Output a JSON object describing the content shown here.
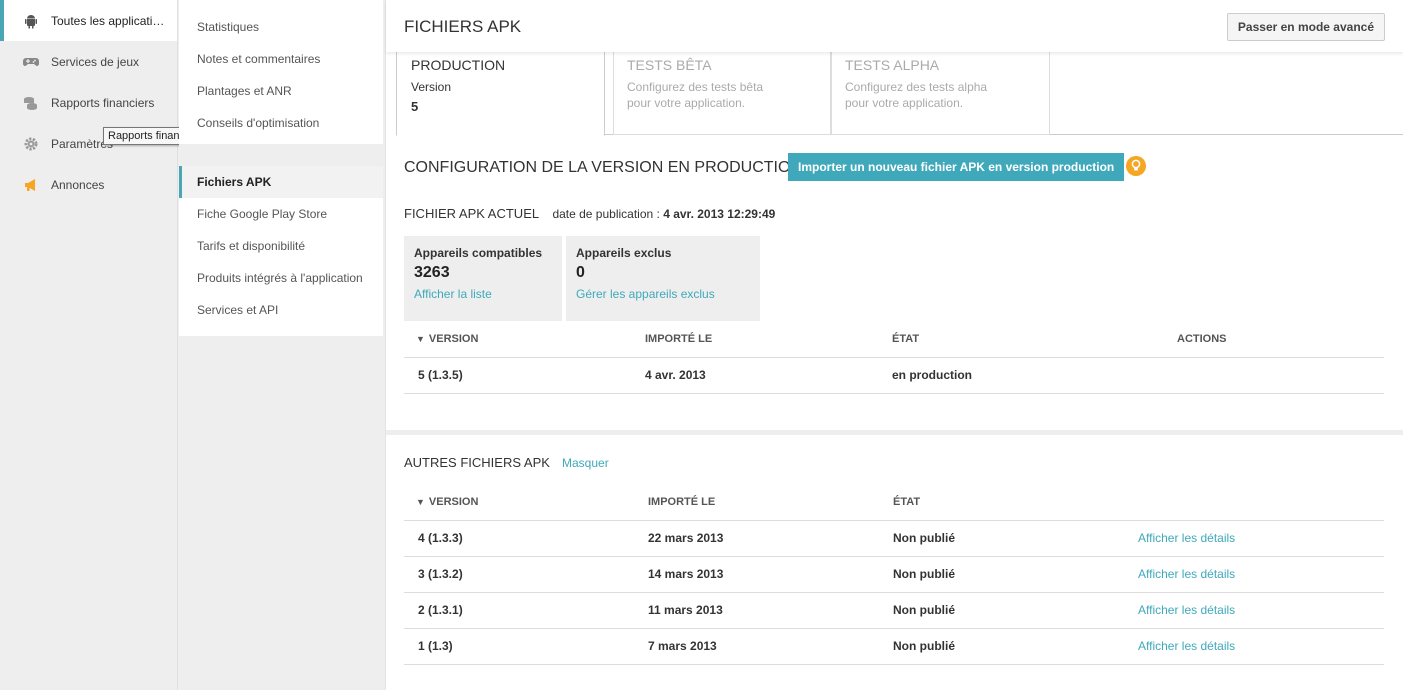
{
  "leftnav": {
    "items": [
      {
        "label": "Toutes les applicati…",
        "icon": "android-icon"
      },
      {
        "label": "Services de jeux",
        "icon": "gamepad-icon"
      },
      {
        "label": "Rapports financiers",
        "icon": "coins-icon"
      },
      {
        "label": "Paramètres",
        "icon": "gear-icon"
      },
      {
        "label": "Annonces",
        "icon": "megaphone-icon"
      }
    ],
    "tooltip": "Rapports financiers"
  },
  "subnav": {
    "group1": [
      "Statistiques",
      "Notes et commentaires",
      "Plantages et ANR",
      "Conseils d'optimisation"
    ],
    "group2": [
      "Fichiers APK",
      "Fiche Google Play Store",
      "Tarifs et disponibilité",
      "Produits intégrés à l'application",
      "Services et API"
    ]
  },
  "header": {
    "title": "FICHIERS APK",
    "advanced_button": "Passer en mode avancé"
  },
  "tabs": [
    {
      "title": "PRODUCTION",
      "desc": "Version",
      "num": "5"
    },
    {
      "title": "TESTS BÊTA",
      "desc": "Configurez des tests bêta pour votre application."
    },
    {
      "title": "TESTS ALPHA",
      "desc": "Configurez des tests alpha pour votre application."
    }
  ],
  "config": {
    "title": "CONFIGURATION DE LA VERSION EN PRODUCTION",
    "import_button": "Importer un nouveau fichier APK en version production",
    "current_label": "FICHIER APK ACTUEL",
    "pub_prefix": "date de publication :",
    "pub_date": "4 avr. 2013 12:29:49",
    "compatible": {
      "title": "Appareils compatibles",
      "value": "3263",
      "link": "Afficher la liste"
    },
    "excluded": {
      "title": "Appareils exclus",
      "value": "0",
      "link": "Gérer les appareils exclus"
    },
    "table": {
      "headers": [
        "VERSION",
        "IMPORTÉ LE",
        "ÉTAT",
        "ACTIONS"
      ],
      "row": {
        "version": "5 (1.3.5)",
        "imported": "4 avr. 2013",
        "state": "en production"
      }
    }
  },
  "other": {
    "title": "AUTRES FICHIERS APK",
    "hide_link": "Masquer",
    "headers": [
      "VERSION",
      "IMPORTÉ LE",
      "ÉTAT"
    ],
    "rows": [
      {
        "version": "4 (1.3.3)",
        "imported": "22 mars 2013",
        "state": "Non publié",
        "action": "Afficher les détails"
      },
      {
        "version": "3 (1.3.2)",
        "imported": "14 mars 2013",
        "state": "Non publié",
        "action": "Afficher les détails"
      },
      {
        "version": "2 (1.3.1)",
        "imported": "11 mars 2013",
        "state": "Non publié",
        "action": "Afficher les détails"
      },
      {
        "version": "1 (1.3)",
        "imported": "7 mars 2013",
        "state": "Non publié",
        "action": "Afficher les détails"
      }
    ]
  },
  "colors": {
    "accent": "#3fa9bb",
    "bulb": "#f5a623"
  }
}
